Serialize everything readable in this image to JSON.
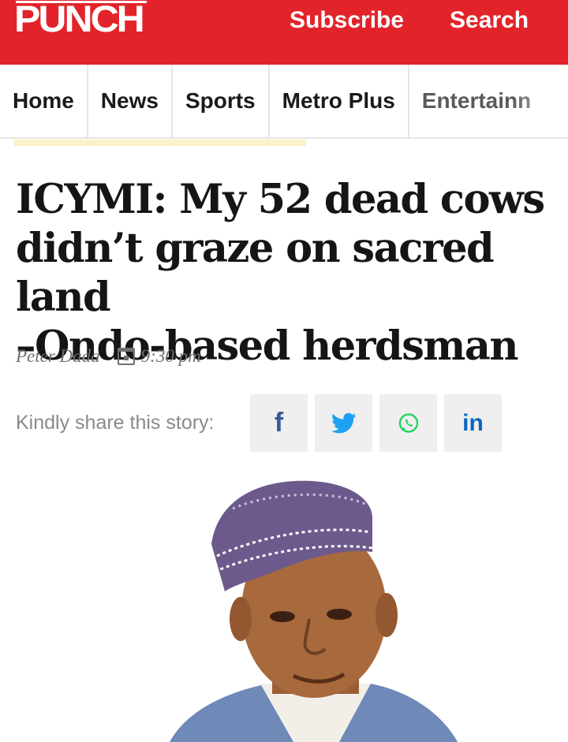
{
  "header": {
    "logo": "PUNCH",
    "subscribe_label": "Subscribe",
    "search_label": "Search",
    "brand_color": "#e2242a"
  },
  "nav": {
    "items": [
      {
        "label": "Home"
      },
      {
        "label": "News"
      },
      {
        "label": "Sports"
      },
      {
        "label": "Metro Plus"
      },
      {
        "label": "Entertainn"
      }
    ]
  },
  "article": {
    "headline_lines": [
      "ICYMI: My 52 dead cows",
      "didn’t graze on sacred land",
      "–Ondo-based herdsman"
    ],
    "author": "Peter Dada",
    "time": "9:30 pm",
    "icons": {
      "date": "calendar-icon"
    }
  },
  "share": {
    "label": "Kindly share this story:",
    "buttons": [
      {
        "icon": "facebook-icon",
        "color": "#3b5998"
      },
      {
        "icon": "twitter-icon",
        "color": "#1da1f2"
      },
      {
        "icon": "whatsapp-icon",
        "color": "#25d366"
      },
      {
        "icon": "linkedin-icon",
        "color": "#0a66c2"
      }
    ]
  }
}
